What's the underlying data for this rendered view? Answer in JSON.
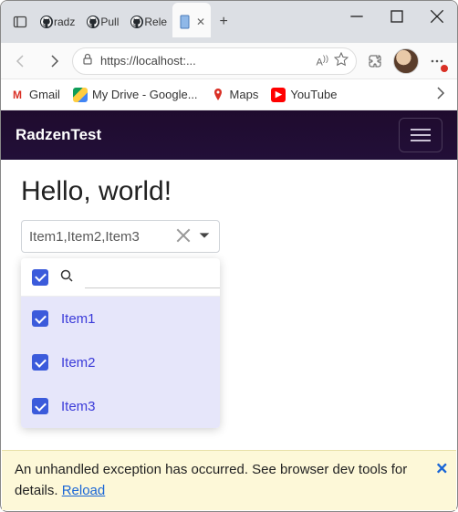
{
  "browser": {
    "tabs": [
      {
        "label": "radz",
        "icon": "github"
      },
      {
        "label": "Pull",
        "icon": "github"
      },
      {
        "label": "Rele",
        "icon": "github"
      },
      {
        "label": "",
        "icon": "page",
        "active": true
      }
    ],
    "url": "https://localhost:...",
    "bookmarks": [
      {
        "label": "Gmail",
        "icon": "gmail"
      },
      {
        "label": "My Drive - Google...",
        "icon": "drive"
      },
      {
        "label": "Maps",
        "icon": "maps"
      },
      {
        "label": "YouTube",
        "icon": "youtube"
      }
    ]
  },
  "app": {
    "brand": "RadzenTest",
    "title": "Hello, world!",
    "dropdown": {
      "displayValue": "Item1,Item2,Item3",
      "selectAllChecked": true,
      "searchValue": "",
      "items": [
        {
          "label": "Item1",
          "checked": true
        },
        {
          "label": "Item2",
          "checked": true
        },
        {
          "label": "Item3",
          "checked": true
        }
      ]
    }
  },
  "error": {
    "message": "An unhandled exception has occurred. See browser dev tools for details. ",
    "reloadLabel": "Reload"
  }
}
